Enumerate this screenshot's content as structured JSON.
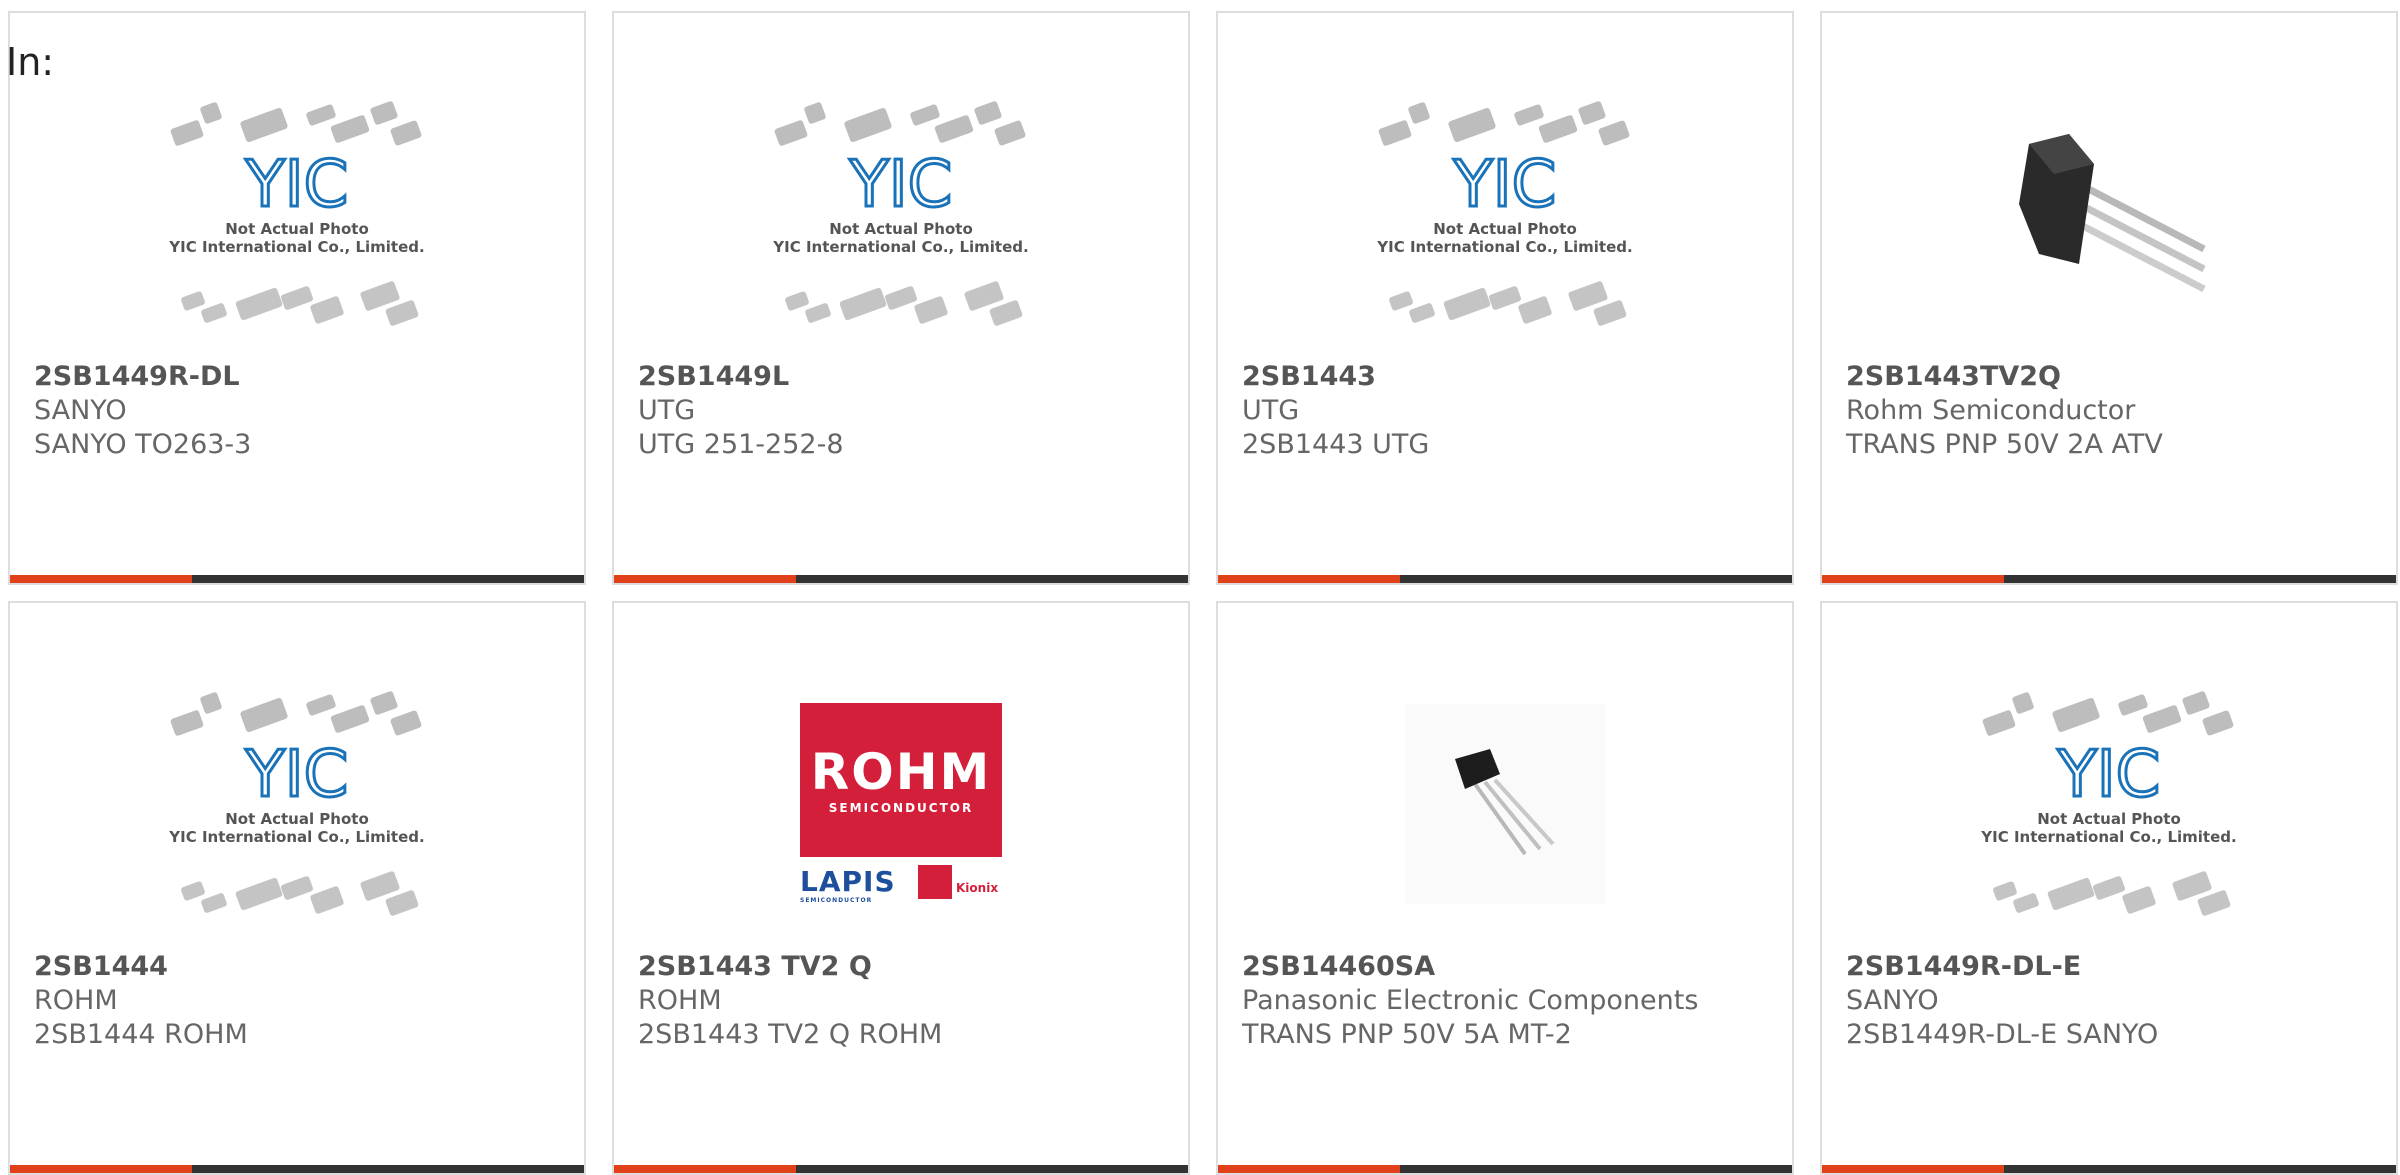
{
  "header": {
    "in_label": "In:"
  },
  "placeholder": {
    "line1": "Not Actual Photo",
    "line2": "YIC International Co., Limited."
  },
  "rohm_logo": {
    "brand": "ROHM",
    "sub": "SEMICONDUCTOR",
    "lapis": "LAPIS",
    "lapis_sub": "SEMICONDUCTOR",
    "kionix": "Kionix"
  },
  "products": [
    {
      "part": "2SB1449R-DL",
      "manufacturer": "SANYO",
      "description": "SANYO TO263-3",
      "image": "yic-placeholder"
    },
    {
      "part": "2SB1449L",
      "manufacturer": "UTG",
      "description": "UTG 251-252-8",
      "image": "yic-placeholder"
    },
    {
      "part": "2SB1443",
      "manufacturer": "UTG",
      "description": "2SB1443 UTG",
      "image": "yic-placeholder"
    },
    {
      "part": "2SB1443TV2Q",
      "manufacturer": "Rohm Semiconductor",
      "description": "TRANS PNP 50V 2A ATV",
      "image": "transistor-photo"
    },
    {
      "part": "2SB1444",
      "manufacturer": "ROHM",
      "description": "2SB1444 ROHM",
      "image": "yic-placeholder"
    },
    {
      "part": "2SB1443 TV2 Q",
      "manufacturer": "ROHM",
      "description": "2SB1443 TV2 Q ROHM",
      "image": "rohm-logo"
    },
    {
      "part": "2SB14460SA",
      "manufacturer": "Panasonic Electronic Components",
      "description": "TRANS PNP 50V 5A MT-2",
      "image": "transistor-photo-small"
    },
    {
      "part": "2SB1449R-DL-E",
      "manufacturer": "SANYO",
      "description": "2SB1449R-DL-E SANYO",
      "image": "yic-placeholder"
    }
  ],
  "colors": {
    "accent": "#e0401a",
    "bar": "#333333",
    "yic_blue": "#1a73b8",
    "rohm_red": "#d31f3a"
  }
}
